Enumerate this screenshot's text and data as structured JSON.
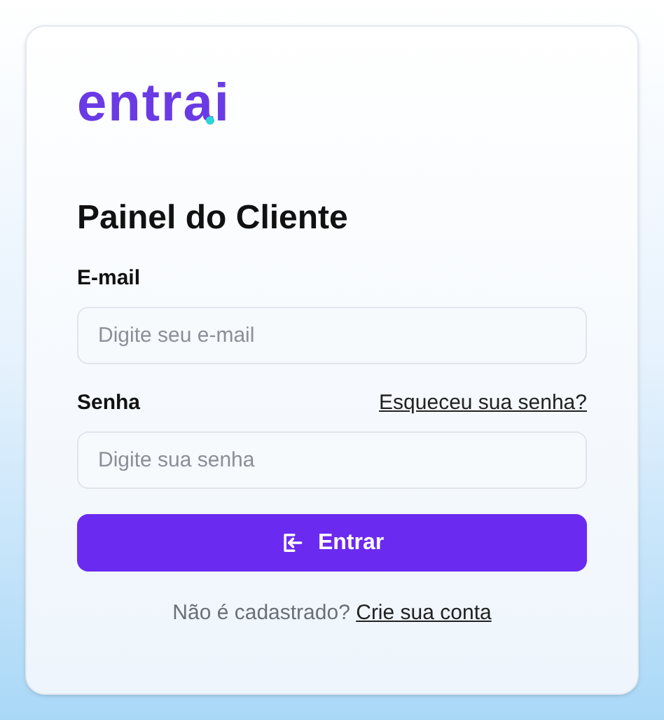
{
  "logo": "entrai",
  "title": "Painel do Cliente",
  "email": {
    "label": "E-mail",
    "placeholder": "Digite seu e-mail"
  },
  "password": {
    "label": "Senha",
    "forgot_link": "Esqueceu sua senha?",
    "placeholder": "Digite sua senha"
  },
  "submit_button": "Entrar",
  "signup": {
    "text": "Não é cadastrado?",
    "link": "Crie sua conta"
  }
}
